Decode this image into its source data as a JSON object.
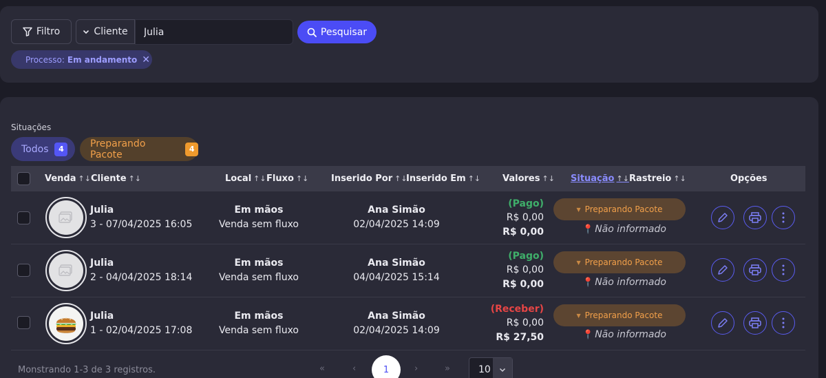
{
  "filter": {
    "filtro_label": "Filtro",
    "cliente_label": "Cliente",
    "search_value": "Julia",
    "pesquisar_label": "Pesquisar",
    "chip_key": "Processo:",
    "chip_value": "Em andamento"
  },
  "situacoes": {
    "label": "Situações",
    "pills": [
      {
        "label": "Todos",
        "count": "4"
      },
      {
        "label": "Preparando Pacote",
        "count": "4"
      }
    ]
  },
  "table": {
    "columns": {
      "venda": "Venda",
      "cliente": "Cliente",
      "local": "Local",
      "fluxo": "Fluxo",
      "inserido_por": "Inserido Por",
      "inserido_em": "Inserido Em",
      "valores": "Valores",
      "situacao": "Situação",
      "rastreio": "Rastreio",
      "opcoes": "Opções"
    },
    "rows": [
      {
        "name": "Julia",
        "venda": "3 - 07/04/2025 16:05",
        "local": "Em mãos",
        "fluxo": "Venda sem fluxo",
        "por": "Ana Simão",
        "em": "02/04/2025 14:09",
        "status": "(Pago)",
        "valor1": "R$ 0,00",
        "valor2": "R$ 0,00",
        "situacao": "Preparando Pacote",
        "rastreio": "Não informado"
      },
      {
        "name": "Julia",
        "venda": "2 - 04/04/2025 18:14",
        "local": "Em mãos",
        "fluxo": "Venda sem fluxo",
        "por": "Ana Simão",
        "em": "04/04/2025 15:14",
        "status": "(Pago)",
        "valor1": "R$ 0,00",
        "valor2": "R$ 0,00",
        "situacao": "Preparando Pacote",
        "rastreio": "Não informado"
      },
      {
        "name": "Julia",
        "venda": "1 - 02/04/2025 17:08",
        "local": "Em mãos",
        "fluxo": "Venda sem fluxo",
        "por": "Ana Simão",
        "em": "02/04/2025 14:09",
        "status": "(Receber)",
        "valor1": "R$ 0,00",
        "valor2": "R$ 27,50",
        "situacao": "Preparando Pacote",
        "rastreio": "Não informado"
      }
    ]
  },
  "footer": {
    "info": "Monstrando 1-3 de 3 registros.",
    "first": "«",
    "prev": "‹",
    "current": "1",
    "next": "›",
    "last": "»",
    "page_size": "10"
  },
  "colors": {
    "accent": "#4b4cf5",
    "pago": "#3fae6a",
    "receber": "#e64545",
    "situacao": "#f2a04a"
  }
}
